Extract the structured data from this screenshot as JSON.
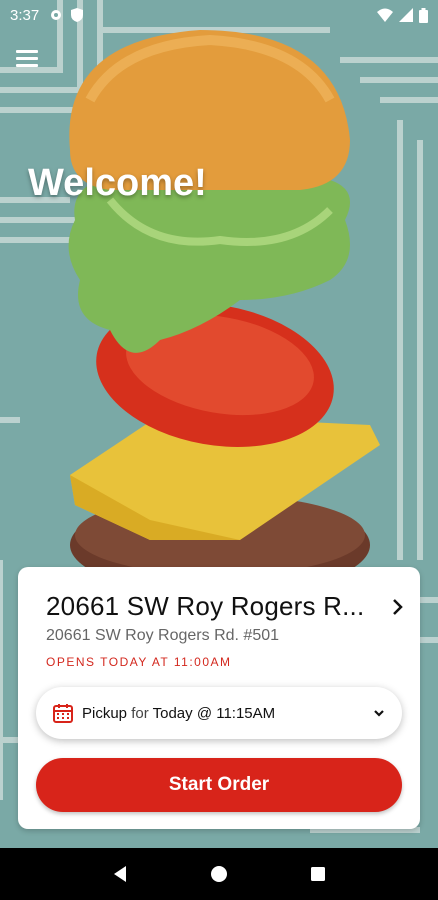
{
  "status_bar": {
    "time": "3:37",
    "left_icons": [
      "gear-icon",
      "shield-icon"
    ],
    "right_icons": [
      "wifi-icon",
      "signal-icon",
      "battery-icon"
    ]
  },
  "menu": {
    "icon": "hamburger-icon"
  },
  "hero": {
    "welcome": "Welcome!"
  },
  "location": {
    "name": "20661 SW Roy Rogers R...",
    "address": "20661 SW Roy Rogers Rd. #501",
    "hours": "OPENS TODAY AT 11:00AM"
  },
  "pickup": {
    "mode": "Pickup",
    "connector": "for",
    "time": "Today @ 11:15AM"
  },
  "actions": {
    "start_order": "Start Order"
  },
  "colors": {
    "accent": "#d8241a",
    "hours_text": "#d3281e",
    "background": "#7aa9a6"
  },
  "nav_bar": [
    "back-icon",
    "home-icon",
    "recents-icon"
  ]
}
